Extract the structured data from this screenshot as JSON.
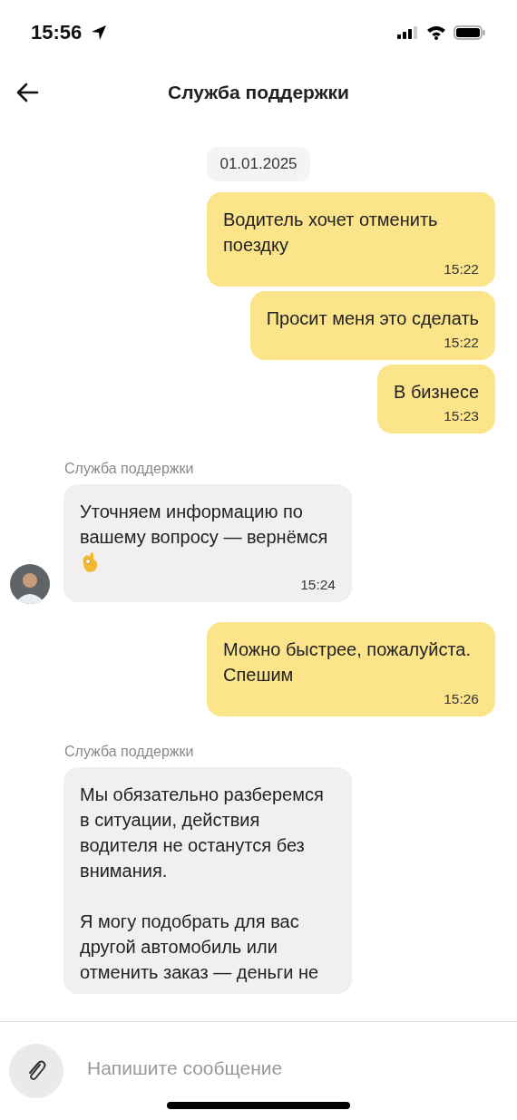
{
  "status_bar": {
    "time": "15:56"
  },
  "header": {
    "title": "Служба поддержки"
  },
  "date_chip": "01.01.2025",
  "messages": [
    {
      "kind": "outgoing",
      "paragraphs": [
        "Водитель хочет отменить поездку"
      ],
      "time": "15:22"
    },
    {
      "kind": "outgoing",
      "paragraphs": [
        "Просит меня это сделать"
      ],
      "time": "15:22"
    },
    {
      "kind": "outgoing",
      "paragraphs": [
        "В бизнесе"
      ],
      "time": "15:23"
    },
    {
      "kind": "incoming",
      "sender": "Служба поддержки",
      "paragraphs": [
        "Уточняем информацию по вашему вопросу — вернёмся"
      ],
      "ok_emoji": true,
      "avatar": true,
      "time": "15:24"
    },
    {
      "kind": "outgoing",
      "paragraphs": [
        "Можно быстрее, пожалуйста. Спешим"
      ],
      "time": "15:26"
    },
    {
      "kind": "incoming",
      "sender": "Служба поддержки",
      "paragraphs": [
        "Мы обязательно разберемся в ситуации, действия водителя не останутся без внимания.",
        "Я могу подобрать для вас другой автомобиль или отменить заказ — деньги не"
      ],
      "avatar": false
    }
  ],
  "composer": {
    "placeholder": "Напишите сообщение"
  }
}
